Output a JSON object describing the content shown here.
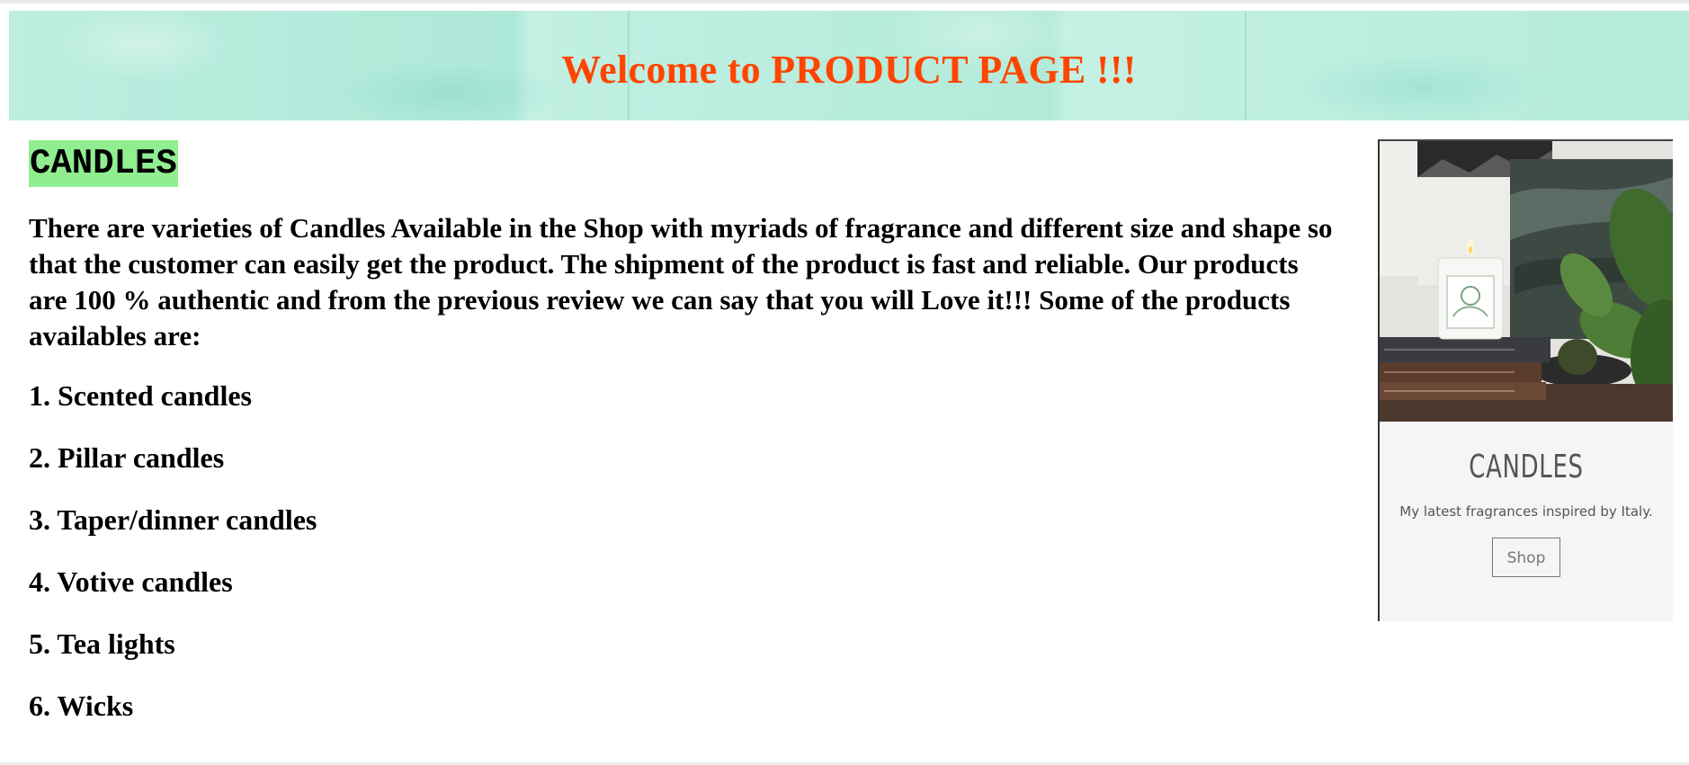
{
  "header": {
    "title": "Welcome to PRODUCT PAGE !!!"
  },
  "main": {
    "category": "CANDLES",
    "intro": "There are varieties of Candles Available in the Shop with myriads of fragrance and different size and shape so that the customer can easily get the product. The shipment of the product is fast and reliable. Our products are 100 % authentic and from the previous review we can say that you will Love it!!! Some of the products availables are:",
    "products": [
      "1. Scented candles",
      "2. Pillar candles",
      "3. Taper/dinner candles",
      "4. Votive candles",
      "5. Tea lights",
      "6. Wicks"
    ]
  },
  "card": {
    "title": "CANDLES",
    "subtitle": "My latest fragrances inspired by Italy.",
    "button_label": "Shop"
  },
  "colors": {
    "header_title": "#ff4500",
    "category_highlight": "#90ee90",
    "header_background": "#b5ebdb"
  }
}
